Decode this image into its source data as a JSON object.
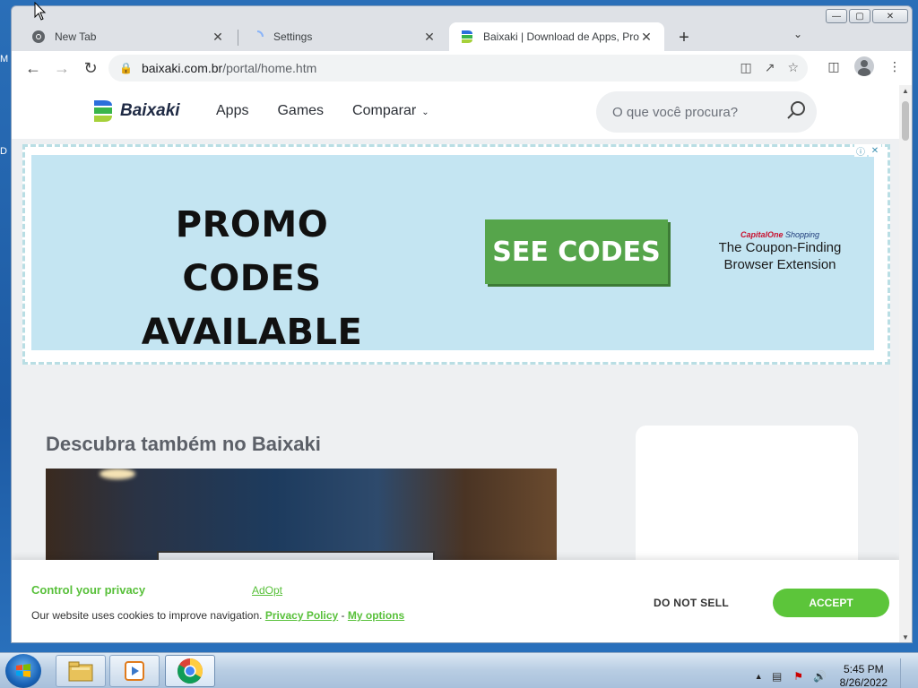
{
  "desktop": {
    "left_fragment_1": "M",
    "left_fragment_2": "D"
  },
  "browser": {
    "tabs": [
      {
        "title": "New Tab"
      },
      {
        "title": "Settings"
      },
      {
        "title": "Baixaki | Download de Apps, Prog"
      }
    ],
    "new_tab_label": "+",
    "url_host": "baixaki.com.br",
    "url_path": "/portal/home.htm"
  },
  "site": {
    "logo_text": "Baixaki",
    "nav": [
      {
        "label": "Apps"
      },
      {
        "label": "Games"
      },
      {
        "label": "Comparar"
      }
    ],
    "search_placeholder": "O que você procura?",
    "ad": {
      "promo_line1": "PROMO CODES",
      "promo_line2": "AVAILABLE",
      "button": "SEE CODES",
      "brand_capital": "Capital",
      "brand_one": "One",
      "brand_shopping": "Shopping",
      "tagline_line1": "The Coupon-Finding",
      "tagline_line2": "Browser Extension"
    },
    "section_title": "Descubra também no Baixaki"
  },
  "privacy": {
    "title": "Control your privacy",
    "adopt": "AdOpt",
    "text": "Our website uses cookies to improve navigation.",
    "privacy_policy": "Privacy Policy",
    "separator": "-",
    "my_options": "My options",
    "do_not_sell": "DO NOT SELL",
    "accept": "ACCEPT"
  },
  "taskbar": {
    "time": "5:45 PM",
    "date": "8/26/2022"
  },
  "colors": {
    "accent_green": "#5cc53a",
    "ad_background": "#c4e5f2",
    "ad_button": "#56a54b"
  }
}
